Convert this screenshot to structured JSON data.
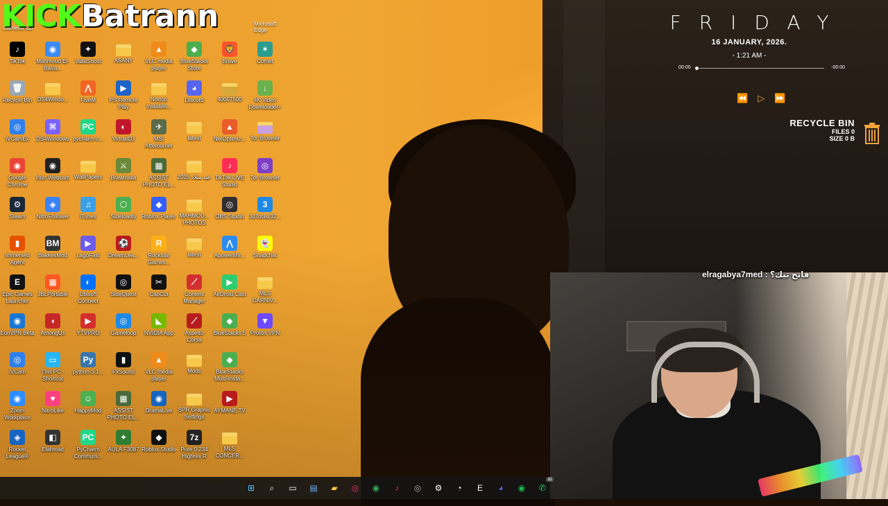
{
  "banner": {
    "platform": "KICK",
    "streamer": "Batrann"
  },
  "top_strip": [
    {
      "label": "CameraHub"
    },
    {
      "label": "pr..."
    },
    {
      "label": "Microsoft Edge"
    }
  ],
  "desktop_icons": [
    {
      "label": "TikTok",
      "icon": "tiktok-icon",
      "color": "#000000",
      "glyph": "♪"
    },
    {
      "label": "Mahmoud El-Batra...",
      "icon": "chrome-icon",
      "color": "#3c8bf2",
      "glyph": "◉"
    },
    {
      "label": "ValiaShoot",
      "icon": "valiashoot-icon",
      "color": "#111111",
      "glyph": "✦"
    },
    {
      "label": "ASANY",
      "icon": "folder-icon",
      "color": "#f6c94a",
      "glyph": ""
    },
    {
      "label": "VLC media player",
      "icon": "vlc-icon",
      "color": "#f08a18",
      "glyph": "▲"
    },
    {
      "label": "BlueStacks Store",
      "icon": "bluestacks-icon",
      "color": "#4cae4f",
      "glyph": "◆"
    },
    {
      "label": "Brave",
      "icon": "brave-icon",
      "color": "#fb542b",
      "glyph": "🦁"
    },
    {
      "label": "Comet",
      "icon": "comet-icon",
      "color": "#2a9d8f",
      "glyph": "✶"
    },
    {
      "label": "Recycle Bin",
      "icon": "recycle-bin-icon",
      "color": "#9aa8b3",
      "glyph": "🗑"
    },
    {
      "label": "DS4Windo...",
      "icon": "folder-icon",
      "color": "#f6c94a",
      "glyph": ""
    },
    {
      "label": "FiveM",
      "icon": "fivem-icon",
      "color": "#f26522",
      "glyph": "⋀"
    },
    {
      "label": "PS Remote Play",
      "icon": "ps-remote-play-icon",
      "color": "#1f63c6",
      "glyph": "▶"
    },
    {
      "label": "Norton Installati...",
      "icon": "folder-icon",
      "color": "#f6c94a",
      "glyph": ""
    },
    {
      "label": "Discord",
      "icon": "discord-icon",
      "color": "#5865f2",
      "glyph": "◕"
    },
    {
      "label": "40007500",
      "icon": "folder-icon",
      "color": "#d6a93a",
      "glyph": ""
    },
    {
      "label": "4K Video Downloader+",
      "icon": "4k-downloader-icon",
      "color": "#6ab04c",
      "glyph": "↓"
    },
    {
      "label": "iVCamEx",
      "icon": "ivcam-icon",
      "color": "#2f80ed",
      "glyph": "◎"
    },
    {
      "label": "DS4Windows",
      "icon": "ds4windows-icon",
      "color": "#7b61ff",
      "glyph": "⌘"
    },
    {
      "label": "pycharm-c...",
      "icon": "pycharm-icon",
      "color": "#21d789",
      "glyph": "PC"
    },
    {
      "label": "VirtualDJ",
      "icon": "virtualdj-icon",
      "color": "#c0182a",
      "glyph": "◐"
    },
    {
      "label": "MSI Afterburner",
      "icon": "msi-afterburner-icon",
      "color": "#5a6b4a",
      "glyph": "✈"
    },
    {
      "label": "latest",
      "icon": "folder-icon",
      "color": "#f6c94a",
      "glyph": ""
    },
    {
      "label": "NetOptimiz...",
      "icon": "netoptimizer-icon",
      "color": "#e85d2a",
      "glyph": "▲"
    },
    {
      "label": "Tor Browser",
      "icon": "folder-icon",
      "color": "#c9a0e0",
      "glyph": ""
    },
    {
      "label": "Google Chrome",
      "icon": "chrome-icon",
      "color": "#ea4335",
      "glyph": "◉"
    },
    {
      "label": "Iriun Webcam",
      "icon": "iriun-webcam-icon",
      "color": "#222222",
      "glyph": "◉"
    },
    {
      "label": "WallPapers",
      "icon": "folder-icon",
      "color": "#f6c94a",
      "glyph": ""
    },
    {
      "label": "Brawlhalla",
      "icon": "brawlhalla-icon",
      "color": "#6a8a3a",
      "glyph": "⚔"
    },
    {
      "label": "ASSIST PHOTO EL...",
      "icon": "photo-icon",
      "color": "#4a6a3a",
      "glyph": "▦"
    },
    {
      "label": "عيد ميلاد 2025",
      "icon": "folder-icon",
      "color": "#f6c94a",
      "glyph": ""
    },
    {
      "label": "TikTok LIVE Studio",
      "icon": "tiktok-live-icon",
      "color": "#ff2d55",
      "glyph": "♪"
    },
    {
      "label": "Tor Browser",
      "icon": "tor-browser-icon",
      "color": "#7d3fc4",
      "glyph": "◎"
    },
    {
      "label": "Steam",
      "icon": "steam-icon",
      "color": "#1b2838",
      "glyph": "⚙"
    },
    {
      "label": "NitroFollower",
      "icon": "nitrofollower-icon",
      "color": "#3b82f6",
      "glyph": "◈"
    },
    {
      "label": "iTunes",
      "icon": "itunes-icon",
      "color": "#3aa0e8",
      "glyph": "♫"
    },
    {
      "label": "Sideloadly",
      "icon": "sideloadly-icon",
      "color": "#4caf50",
      "glyph": "⬡"
    },
    {
      "label": "Roblox Player",
      "icon": "roblox-icon",
      "color": "#335fff",
      "glyph": "◆"
    },
    {
      "label": "MAHMOU... PHOTOS",
      "icon": "folder-icon",
      "color": "#f6c94a",
      "glyph": ""
    },
    {
      "label": "OBS Studio",
      "icon": "obs-icon",
      "color": "#302e31",
      "glyph": "◎"
    },
    {
      "label": "3uTools(32...",
      "icon": "3utools-icon",
      "color": "#1e88e5",
      "glyph": "3"
    },
    {
      "label": "Immersed Agent",
      "icon": "immersed-icon",
      "color": "#e65100",
      "glyph": "▮"
    },
    {
      "label": "BakkesMod",
      "icon": "bakkesmod-icon",
      "color": "#333333",
      "glyph": "BM"
    },
    {
      "label": "LagoFast",
      "icon": "lagofast-icon",
      "color": "#6c5ce7",
      "glyph": "▶"
    },
    {
      "label": "DreamLea...",
      "icon": "dreamleague-icon",
      "color": "#b71c1c",
      "glyph": "⚽"
    },
    {
      "label": "Rockstar Games...",
      "icon": "rockstar-icon",
      "color": "#fcaf17",
      "glyph": "R"
    },
    {
      "label": "latest",
      "icon": "folder-icon",
      "color": "#f6c94a",
      "glyph": ""
    },
    {
      "label": "ApowerMir...",
      "icon": "apowermirror-icon",
      "color": "#2d8cf0",
      "glyph": "⋀"
    },
    {
      "label": "Snapchat",
      "icon": "snapchat-icon",
      "color": "#fffc00",
      "glyph": "👻"
    },
    {
      "label": "Epic Games Launcher",
      "icon": "epic-games-icon",
      "color": "#111111",
      "glyph": "E"
    },
    {
      "label": "JBLPortable",
      "icon": "jbl-icon",
      "color": "#ff5722",
      "glyph": "▦"
    },
    {
      "label": "Ubisoft Connect",
      "icon": "ubisoft-icon",
      "color": "#0070ff",
      "glyph": "◐"
    },
    {
      "label": "SideQuest",
      "icon": "sidequest-icon",
      "color": "#111111",
      "glyph": "◎"
    },
    {
      "label": "CapCut",
      "icon": "capcut-icon",
      "color": "#111111",
      "glyph": "✂"
    },
    {
      "label": "Content Manager",
      "icon": "content-manager-icon",
      "color": "#d32f2f",
      "glyph": "⟋"
    },
    {
      "label": "AirDroid Cast",
      "icon": "airdroid-icon",
      "color": "#2ecc71",
      "glyph": "▶"
    },
    {
      "label": "MLS CARNIV...",
      "icon": "folder-icon",
      "color": "#f6c94a",
      "glyph": ""
    },
    {
      "label": "EonVPN Beta",
      "icon": "eonvpn-icon",
      "color": "#1976d2",
      "glyph": "◉"
    },
    {
      "label": "AmongUs",
      "icon": "among-us-icon",
      "color": "#c62828",
      "glyph": "◖"
    },
    {
      "label": "YTVPRO",
      "icon": "ytvpro-icon",
      "color": "#d32f2f",
      "glyph": "▶"
    },
    {
      "label": "Gameloop",
      "icon": "gameloop-icon",
      "color": "#1e88e5",
      "glyph": "◎"
    },
    {
      "label": "NVIDIA App",
      "icon": "nvidia-icon",
      "color": "#76b900",
      "glyph": "◣"
    },
    {
      "label": "Assetto Corsa",
      "icon": "assetto-corsa-icon",
      "color": "#b71c1c",
      "glyph": "⟋"
    },
    {
      "label": "BlueStacks 5",
      "icon": "bluestacks-icon",
      "color": "#4cae4f",
      "glyph": "◆"
    },
    {
      "label": "Proton VPN",
      "icon": "proton-vpn-icon",
      "color": "#6d4aff",
      "glyph": "▼"
    },
    {
      "label": "iVCam",
      "icon": "ivcam-icon",
      "color": "#2f80ed",
      "glyph": "◎"
    },
    {
      "label": "This PC - Shortcut",
      "icon": "this-pc-icon",
      "color": "#29b6f6",
      "glyph": "▭"
    },
    {
      "label": "python-3.1...",
      "icon": "python-icon",
      "color": "#3776ab",
      "glyph": "Py"
    },
    {
      "label": "FxSound",
      "icon": "fxsound-icon",
      "color": "#111111",
      "glyph": "▮"
    },
    {
      "label": "VLC media player",
      "icon": "vlc-icon",
      "color": "#f08a18",
      "glyph": "▲"
    },
    {
      "label": "Mods",
      "icon": "folder-icon",
      "color": "#f6c94a",
      "glyph": ""
    },
    {
      "label": "BlueStacks Multi-Insta...",
      "icon": "bluestacks-multi-icon",
      "color": "#4cae4f",
      "glyph": "◆"
    },
    {
      "label": "",
      "icon": "blank",
      "color": "transparent",
      "glyph": ""
    },
    {
      "label": "Zoom Workplace",
      "icon": "zoom-icon",
      "color": "#2d8cff",
      "glyph": "◉"
    },
    {
      "label": "NitroLike",
      "icon": "nitrolike-icon",
      "color": "#ff4081",
      "glyph": "♥"
    },
    {
      "label": "HappyMod",
      "icon": "happymod-icon",
      "color": "#4caf50",
      "glyph": "☺"
    },
    {
      "label": "ASSIST PHOTO EL...",
      "icon": "photo-icon",
      "color": "#4a6a3a",
      "glyph": "▦"
    },
    {
      "label": "DramaLive",
      "icon": "dramalive-icon",
      "color": "#1565c0",
      "glyph": "◉"
    },
    {
      "label": "SPR Graphic Settings",
      "icon": "folder-icon",
      "color": "#f6c94a",
      "glyph": ""
    },
    {
      "label": "AYMANE TV",
      "icon": "aymane-tv-icon",
      "color": "#b71c1c",
      "glyph": "▶"
    },
    {
      "label": "",
      "icon": "blank",
      "color": "transparent",
      "glyph": ""
    },
    {
      "label": "Rocket League®",
      "icon": "rocket-league-icon",
      "color": "#1565c0",
      "glyph": "◈"
    },
    {
      "label": "Elahmad",
      "icon": "elahmad-icon",
      "color": "#333333",
      "glyph": "◧"
    },
    {
      "label": "PyCharm Communi...",
      "icon": "pycharm-icon",
      "color": "#21d789",
      "glyph": "PC"
    },
    {
      "label": "AULA F3087",
      "icon": "aula-icon",
      "color": "#2e7d32",
      "glyph": "✦"
    },
    {
      "label": "Roblox Studio",
      "icon": "roblox-studio-icon",
      "color": "#111111",
      "glyph": "◆"
    },
    {
      "label": "Pure 0.234 Highres R",
      "icon": "7zip-icon",
      "color": "#222222",
      "glyph": "7z"
    },
    {
      "label": "MLS CONCER...",
      "icon": "folder-icon",
      "color": "#f6c94a",
      "glyph": ""
    },
    {
      "label": "",
      "icon": "blank",
      "color": "transparent",
      "glyph": ""
    }
  ],
  "clock_widget": {
    "day": "FRIDAY",
    "date": "16  JANUARY, 2026.",
    "time": "- 1:21 AM -",
    "elapsed": "00:00",
    "remaining": "-00:00"
  },
  "media_controls": {
    "prev": "⏪",
    "play": "▷",
    "next": "⏩"
  },
  "recycle_widget": {
    "title": "RECYCLE BIN",
    "files": "FILES 0",
    "size": "SIZE 0 B"
  },
  "chat": {
    "text": "elragabya7med : فاتح تيك؟"
  },
  "taskbar": [
    {
      "name": "start-icon",
      "glyph": "⊞",
      "color": "#4cc2ff"
    },
    {
      "name": "search-icon",
      "glyph": "⌕",
      "color": "#ffffff"
    },
    {
      "name": "task-view-icon",
      "glyph": "▭",
      "color": "#ffffff"
    },
    {
      "name": "widgets-icon",
      "glyph": "▤",
      "color": "#6ab0ff"
    },
    {
      "name": "file-explorer-icon",
      "glyph": "▰",
      "color": "#f6c94a"
    },
    {
      "name": "instagram-icon",
      "glyph": "◎",
      "color": "#e1306c"
    },
    {
      "name": "chrome-icon",
      "glyph": "◉",
      "color": "#34a853"
    },
    {
      "name": "tiktok-icon",
      "glyph": "♪",
      "color": "#ff2d55"
    },
    {
      "name": "obs-icon",
      "glyph": "◎",
      "color": "#aaaaaa"
    },
    {
      "name": "settings-icon",
      "glyph": "⚙",
      "color": "#ffffff"
    },
    {
      "name": "speedometer-icon",
      "glyph": "◔",
      "color": "#ffffff"
    },
    {
      "name": "epic-games-icon",
      "glyph": "E",
      "color": "#ffffff"
    },
    {
      "name": "discord-icon",
      "glyph": "◕",
      "color": "#5865f2"
    },
    {
      "name": "spotify-icon",
      "glyph": "◉",
      "color": "#1db954"
    },
    {
      "name": "whatsapp-icon",
      "glyph": "✆",
      "color": "#25d366",
      "badge": "32"
    }
  ]
}
